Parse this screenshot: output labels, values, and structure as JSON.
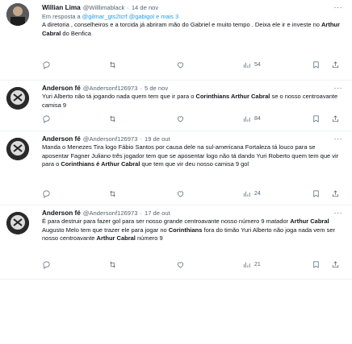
{
  "tweets": [
    {
      "name": "Willian Lima",
      "handle": "@Willlimablack",
      "sep": "·",
      "date": "14 de nov",
      "reply_prefix": "Em resposta a",
      "reply_handles": "@gilmar_gts2tcrf @gabigol e mais 3",
      "segments": [
        {
          "t": "A diretoria , conselheiros e a torcida já abriram mão do Gabriel e muito tempo . Deixa ele ir e investe no ",
          "b": false
        },
        {
          "t": "Arthur Cabral",
          "b": true
        },
        {
          "t": " do Benfica",
          "b": false
        }
      ],
      "stats": {
        "views": "54"
      },
      "avatar_color": "#3a3a3a"
    },
    {
      "name": "Anderson fé",
      "handle": "@Andersonf126973",
      "sep": "·",
      "date": "5 de nov",
      "segments": [
        {
          "t": "Yuri Alberto não tá jogando nada quem tem que ir para o ",
          "b": false
        },
        {
          "t": "Corinthians Arthur Cabral",
          "b": true
        },
        {
          "t": " se o nosso centroavante camisa 9",
          "b": false
        }
      ],
      "stats": {
        "views": "84"
      },
      "avatar_color": "#2d2d2d"
    },
    {
      "name": "Anderson fé",
      "handle": "@Andersonf126973",
      "sep": "·",
      "date": "19 de out",
      "segments": [
        {
          "t": "Manda o Menezes Tira logo Fábio Santos por causa dele na sul-americana Fortaleza tá louco para se aposentar Fagner Juliano três jogador tem que se aposentar logo não tá dando Yuri Roberto quem tem que vir para o ",
          "b": false
        },
        {
          "t": "Corinthians é Arthur Cabral",
          "b": true
        },
        {
          "t": " que tem que vir deu nosso camisa 9 gol",
          "b": false
        }
      ],
      "stats": {
        "views": "24"
      },
      "avatar_color": "#2d2d2d"
    },
    {
      "name": "Anderson fé",
      "handle": "@Andersonf126973",
      "sep": "·",
      "date": "17 de out",
      "segments": [
        {
          "t": "É para destruir para fazer gol para ser nosso grande centroavante nosso número 9 matador ",
          "b": false
        },
        {
          "t": "Arthur Cabral",
          "b": true
        },
        {
          "t": " Augusto Melo tem que trazer ele para jogar no ",
          "b": false
        },
        {
          "t": "Corinthians",
          "b": true
        },
        {
          "t": " fora do timão Yuri Alberto não joga nada vem ser nosso centroavante ",
          "b": false
        },
        {
          "t": "Arthur Cabral",
          "b": true
        },
        {
          "t": " número 9",
          "b": false
        }
      ],
      "stats": {
        "views": "21"
      },
      "avatar_color": "#2d2d2d"
    }
  ],
  "icons": {
    "more": "more-dots-icon",
    "reply": "reply-icon",
    "retweet": "retweet-icon",
    "like": "like-icon",
    "views": "views-icon",
    "bookmark": "bookmark-icon",
    "share": "share-icon"
  },
  "colors": {
    "link": "#1d9bf0",
    "muted": "#536471",
    "text": "#0f1419"
  }
}
